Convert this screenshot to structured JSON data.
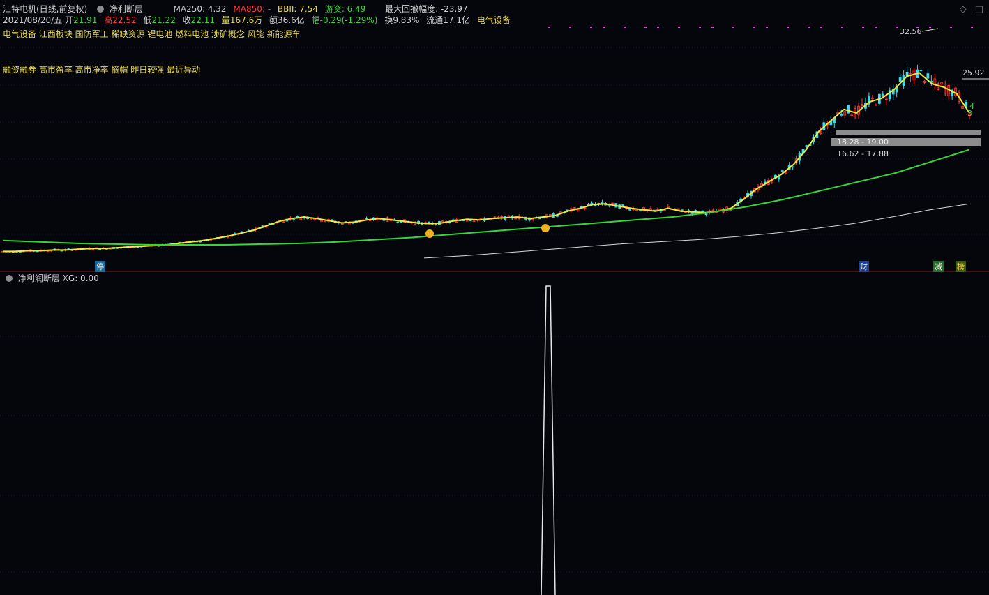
{
  "header": {
    "stock": "江特电机(日线,前复权)",
    "indicator": "净利断层",
    "ma250": "MA250: 4.32",
    "ma850": "MA850: -",
    "bbii": "BBII: 7.54",
    "youzi": "游资: 6.49",
    "drawdown": "最大回撤幅度: -23.97"
  },
  "quote": {
    "date": "2021/08/20/五",
    "open_label": "开",
    "open": "21.91",
    "high_label": "高",
    "high": "22.52",
    "low_label": "低",
    "low": "21.22",
    "close_label": "收",
    "close": "22.11",
    "vol": "量167.6万",
    "amount": "额36.6亿",
    "change": "幅-0.29(-1.29%)",
    "turnover": "换9.83%",
    "float": "流通17.1亿",
    "sector": "电气设备"
  },
  "tags1": "电气设备 江西板块 国防军工 稀缺资源 锂电池 燃料电池 涉矿概念 风能 新能源车",
  "tags2": "融资融券 高市盈率 高市净率 摘帽 昨日较强 最近异动",
  "labels": {
    "peak": "32.56",
    "right_price": "25.92",
    "zone1": "18.28 - 19.00",
    "zone2": "16.62 - 17.88",
    "num_a": "4",
    "num_b": "3",
    "marker_ting": "停",
    "marker_cai": "财",
    "marker_jian": "减",
    "marker_bang": "榜"
  },
  "sub_panel": {
    "title": "净利润断层",
    "value": "XG: 0.00"
  },
  "colors": {
    "up": "#ff3b3b",
    "down": "#40d8e8",
    "ma_short": "#f2ea3a",
    "ma_mid": "#37d637",
    "ma_long": "#d8d8d8",
    "zone": "#8c8c8c",
    "signal": "#e040e0"
  },
  "chart_data": {
    "type": "line",
    "ylim": [
      2,
      34
    ],
    "x_count": 280,
    "series": [
      {
        "values": [
          3.1,
          3.1,
          3.2,
          3.2,
          3.3,
          3.3,
          3.4,
          3.5,
          3.5,
          3.6,
          3.7,
          3.8,
          3.9,
          4.0,
          4.2,
          4.4,
          4.6,
          4.9,
          5.2,
          5.6,
          6.0,
          6.6,
          7.2,
          7.6,
          7.8,
          7.6,
          7.3,
          7.0,
          7.1,
          7.4,
          7.6,
          7.4,
          7.2,
          7.0,
          6.9,
          7.0,
          7.3,
          7.5,
          7.4,
          7.6,
          7.7,
          7.8,
          7.6,
          7.8,
          8.0,
          8.6,
          9.0,
          9.5,
          9.6,
          9.3,
          9.0,
          8.8,
          8.6,
          9.0,
          8.6,
          8.5,
          8.4,
          8.6,
          9.0,
          10.2,
          11.6,
          12.6,
          13.6,
          15.0,
          17.0,
          19.5,
          21.0,
          22.5,
          22.0,
          23.5,
          24.0,
          25.2,
          27.0,
          27.5,
          26.0,
          25.5,
          24.6,
          22.0
        ]
      },
      {
        "values": [
          4.6,
          4.4,
          4.2,
          4.1,
          4.0,
          4.0,
          4.0,
          4.1,
          4.2,
          4.4,
          4.7,
          5.0,
          5.4,
          5.8,
          6.2,
          6.6,
          7.0,
          7.4,
          7.8,
          8.4,
          9.2,
          10.2,
          11.4,
          12.6,
          13.8,
          15.4,
          17.0
        ]
      },
      {
        "values": [
          2.2,
          2.5,
          2.9,
          3.3,
          3.7,
          4.1,
          4.4,
          4.7,
          5.1,
          5.6,
          6.2,
          6.9,
          7.8,
          8.8,
          9.6
        ]
      }
    ],
    "annotations": [
      "32.56",
      "25.92",
      "18.28 - 19.00",
      "16.62 - 17.88"
    ]
  }
}
